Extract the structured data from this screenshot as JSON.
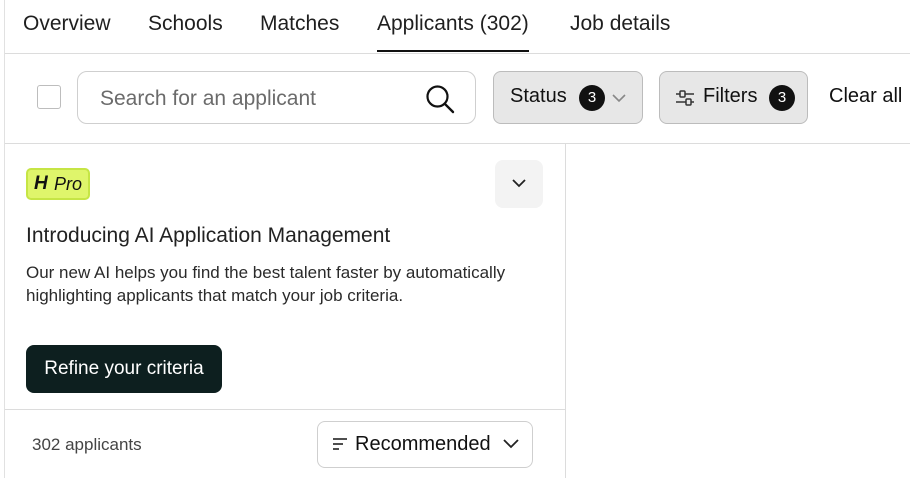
{
  "tabs": [
    {
      "label": "Overview",
      "active": false
    },
    {
      "label": "Schools",
      "active": false
    },
    {
      "label": "Matches",
      "active": false
    },
    {
      "label": "Applicants (302)",
      "active": true
    },
    {
      "label": "Job details",
      "active": false
    }
  ],
  "toolbar": {
    "search_placeholder": "Search for an applicant",
    "status_label": "Status",
    "status_count": "3",
    "filters_label": "Filters",
    "filters_count": "3",
    "clear_label": "Clear all"
  },
  "promo": {
    "badge_h": "H",
    "badge_pro": "Pro",
    "title": "Introducing AI Application Management",
    "body": "Our new AI helps you find the best talent faster by automatically highlighting applicants that match your job criteria.",
    "cta": "Refine your criteria",
    "badge_color": "#dff56b"
  },
  "list": {
    "count_text": "302 applicants",
    "sort_label": "Recommended"
  },
  "icons": [
    "search-icon",
    "chevron-down-icon",
    "sliders-icon",
    "sort-icon"
  ]
}
